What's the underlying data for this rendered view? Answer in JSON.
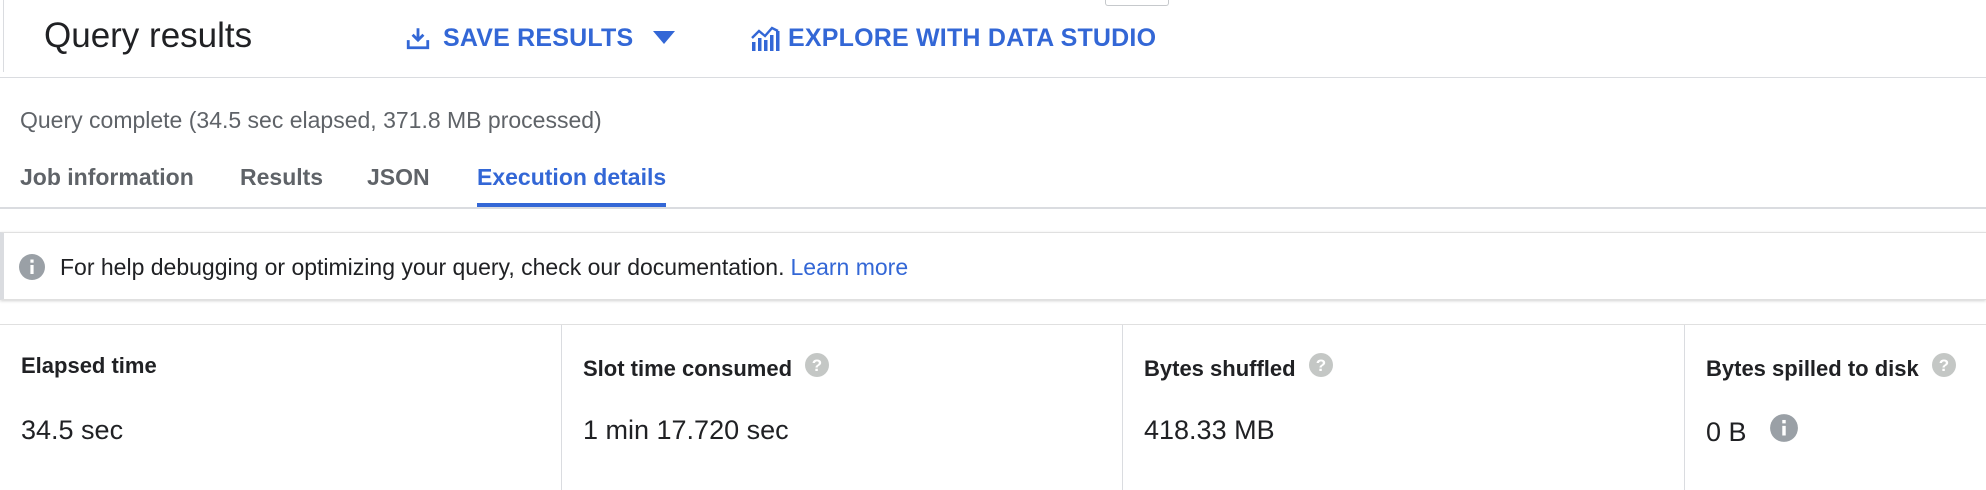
{
  "header": {
    "title": "Query results",
    "save_label": "SAVE RESULTS",
    "explore_label": "EXPLORE WITH DATA STUDIO"
  },
  "status_text": "Query complete (34.5 sec elapsed, 371.8 MB processed)",
  "tabs": [
    {
      "label": "Job information",
      "active": false
    },
    {
      "label": "Results",
      "active": false
    },
    {
      "label": "JSON",
      "active": false
    },
    {
      "label": "Execution details",
      "active": true
    }
  ],
  "banner": {
    "message": "For help debugging or optimizing your query, check our documentation.",
    "link_label": "Learn more"
  },
  "stats": [
    {
      "label": "Elapsed time",
      "value": "34.5 sec",
      "help_icon": false
    },
    {
      "label": "Slot time consumed",
      "value": "1 min 17.720 sec",
      "help_icon": true
    },
    {
      "label": "Bytes shuffled",
      "value": "418.33 MB",
      "help_icon": true
    },
    {
      "label": "Bytes spilled to disk",
      "value": "0 B",
      "help_icon": true,
      "value_info_icon": true
    }
  ],
  "icons": {
    "save": "download-icon",
    "caret": "caret-down-icon",
    "explore": "data-studio-icon",
    "info": "info-icon",
    "help": "help-icon"
  },
  "colors": {
    "accent": "#3367d6",
    "text": "#202124",
    "muted": "#5f6368",
    "icon_grey": "#9aa0a6",
    "help_grey": "#c4c7c5",
    "border": "#dadce0"
  }
}
